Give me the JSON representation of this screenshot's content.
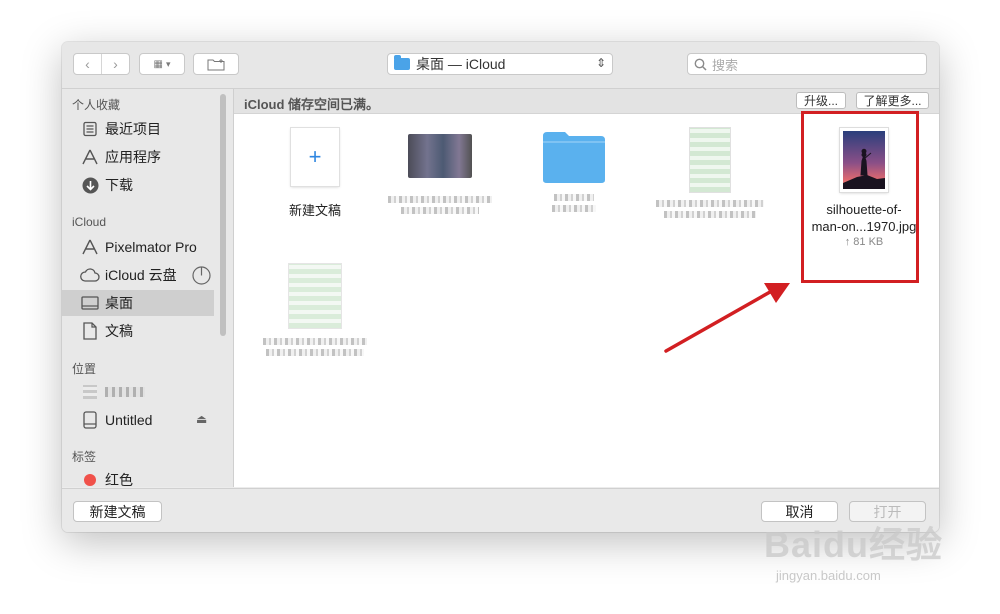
{
  "toolbar": {
    "location": "桌面 — iCloud",
    "search_placeholder": "搜索"
  },
  "sidebar": {
    "favorites_heading": "个人收藏",
    "favorites": [
      {
        "label": "最近项目",
        "icon": "recents-icon"
      },
      {
        "label": "应用程序",
        "icon": "applications-icon"
      },
      {
        "label": "下载",
        "icon": "downloads-icon"
      }
    ],
    "icloud_heading": "iCloud",
    "icloud": [
      {
        "label": "Pixelmator Pro",
        "icon": "pixelmator-icon"
      },
      {
        "label": "iCloud 云盘",
        "icon": "icloud-drive-icon"
      },
      {
        "label": "桌面",
        "icon": "desktop-icon",
        "selected": true
      },
      {
        "label": "文稿",
        "icon": "documents-icon"
      }
    ],
    "locations_heading": "位置",
    "locations": [
      {
        "label": "",
        "icon": "computer-icon"
      },
      {
        "label": "Untitled",
        "icon": "disk-icon"
      }
    ],
    "tags_heading": "标签",
    "tags": [
      {
        "label": "红色",
        "color": "#f0514a"
      }
    ]
  },
  "banner": {
    "message": "iCloud 储存空间已满。",
    "upgrade_label": "升级...",
    "learn_more_label": "了解更多..."
  },
  "content": {
    "new_document_label": "新建文稿",
    "selected_file": {
      "name_line1": "silhouette-of-",
      "name_line2": "man-on...1970.jpg",
      "size": "↑ 81 KB"
    }
  },
  "buttons": {
    "new_document": "新建文稿",
    "cancel": "取消",
    "open": "打开"
  },
  "watermark": {
    "brand": "Baidu经验",
    "url": "jingyan.baidu.com"
  },
  "colors": {
    "highlight": "#d21f22",
    "folder_blue": "#5ab1ee"
  }
}
